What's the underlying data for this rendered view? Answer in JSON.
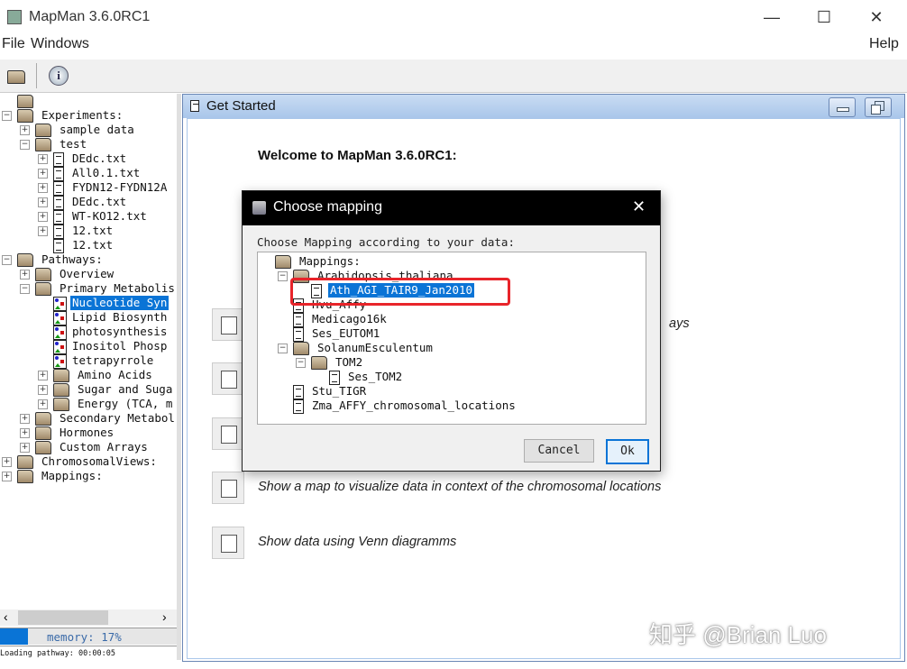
{
  "window": {
    "title": "MapMan 3.6.0RC1",
    "minimize": "—",
    "maximize": "☐",
    "close": "✕"
  },
  "menu": {
    "file": "File",
    "windows": "Windows",
    "help": "Help"
  },
  "toolbar": {
    "open_icon": "folder-open-icon",
    "info_icon": "info-icon"
  },
  "left_tree": [
    {
      "level": 0,
      "type": "folder",
      "exp": "",
      "label": ""
    },
    {
      "level": 0,
      "type": "folder",
      "exp": "−",
      "label": "Experiments:"
    },
    {
      "level": 1,
      "type": "folder",
      "exp": "+",
      "label": "sample data"
    },
    {
      "level": 1,
      "type": "folder",
      "exp": "−",
      "label": "test"
    },
    {
      "level": 2,
      "type": "doc",
      "exp": "+",
      "label": "DEdc.txt"
    },
    {
      "level": 2,
      "type": "doc",
      "exp": "+",
      "label": "All0.1.txt"
    },
    {
      "level": 2,
      "type": "doc",
      "exp": "+",
      "label": "FYDN12-FYDN12A"
    },
    {
      "level": 2,
      "type": "doc",
      "exp": "+",
      "label": "DEdc.txt"
    },
    {
      "level": 2,
      "type": "doc",
      "exp": "+",
      "label": "WT-KO12.txt"
    },
    {
      "level": 2,
      "type": "doc",
      "exp": "+",
      "label": "12.txt"
    },
    {
      "level": 2,
      "type": "doc",
      "exp": "",
      "label": "12.txt"
    },
    {
      "level": 0,
      "type": "folder",
      "exp": "−",
      "label": "Pathways:"
    },
    {
      "level": 1,
      "type": "folder",
      "exp": "+",
      "label": "Overview"
    },
    {
      "level": 1,
      "type": "folder",
      "exp": "−",
      "label": "Primary Metabolis"
    },
    {
      "level": 2,
      "type": "path",
      "exp": "",
      "label": "Nucleotide Syn",
      "selected": true
    },
    {
      "level": 2,
      "type": "path",
      "exp": "",
      "label": "Lipid Biosynth"
    },
    {
      "level": 2,
      "type": "path",
      "exp": "",
      "label": "photosynthesis"
    },
    {
      "level": 2,
      "type": "path",
      "exp": "",
      "label": "Inositol Phosp"
    },
    {
      "level": 2,
      "type": "path",
      "exp": "",
      "label": "tetrapyrrole"
    },
    {
      "level": 2,
      "type": "folder",
      "exp": "+",
      "label": "Amino Acids"
    },
    {
      "level": 2,
      "type": "folder",
      "exp": "+",
      "label": "Sugar and Suga"
    },
    {
      "level": 2,
      "type": "folder",
      "exp": "+",
      "label": "Energy (TCA, m"
    },
    {
      "level": 1,
      "type": "folder",
      "exp": "+",
      "label": "Secondary Metabol"
    },
    {
      "level": 1,
      "type": "folder",
      "exp": "+",
      "label": "Hormones"
    },
    {
      "level": 1,
      "type": "folder",
      "exp": "+",
      "label": "Custom Arrays"
    },
    {
      "level": 0,
      "type": "folder",
      "exp": "+",
      "label": "ChromosomalViews:"
    },
    {
      "level": 0,
      "type": "folder",
      "exp": "+",
      "label": "Mappings:"
    }
  ],
  "memory": {
    "label": "memory: 17%",
    "percent": 17
  },
  "status": "Loading pathway: 00:00:05",
  "frame": {
    "title": "Get Started",
    "welcome": "Welcome to MapMan 3.6.0RC1:",
    "actions": [
      {
        "icon": "pathway-icon",
        "text": "ays"
      },
      {
        "icon": "compare-icon",
        "text": ""
      },
      {
        "icon": "flask-icon",
        "text": ""
      },
      {
        "icon": "chromosome-icon",
        "text": "Show a map to visualize data in context of the chromosomal locations"
      },
      {
        "icon": "venn-icon",
        "text": "Show data using Venn diagramms"
      }
    ]
  },
  "dialog": {
    "title": "Choose mapping",
    "prompt": "Choose Mapping according to your data:",
    "tree": [
      {
        "level": 0,
        "type": "folder",
        "exp": "",
        "label": "Mappings:"
      },
      {
        "level": 1,
        "type": "folder",
        "exp": "−",
        "label": "Arabidopsis_thaliana"
      },
      {
        "level": 2,
        "type": "doc",
        "exp": "",
        "label": "Ath_AGI_TAIR9_Jan2010",
        "selected": true
      },
      {
        "level": 1,
        "type": "doc",
        "exp": "",
        "label": "Hvu_Affy"
      },
      {
        "level": 1,
        "type": "doc",
        "exp": "",
        "label": "Medicago16k"
      },
      {
        "level": 1,
        "type": "doc",
        "exp": "",
        "label": "Ses_EUTOM1"
      },
      {
        "level": 1,
        "type": "folder",
        "exp": "−",
        "label": "SolanumEsculentum"
      },
      {
        "level": 2,
        "type": "folder",
        "exp": "−",
        "label": "TOM2"
      },
      {
        "level": 3,
        "type": "doc",
        "exp": "",
        "label": "Ses_TOM2"
      },
      {
        "level": 1,
        "type": "doc",
        "exp": "",
        "label": "Stu_TIGR"
      },
      {
        "level": 1,
        "type": "doc",
        "exp": "",
        "label": "Zma_AFFY_chromosomal_locations"
      }
    ],
    "cancel": "Cancel",
    "ok": "Ok",
    "highlight_color": "#e8242a"
  },
  "watermark": "知乎 @Brian Luo"
}
